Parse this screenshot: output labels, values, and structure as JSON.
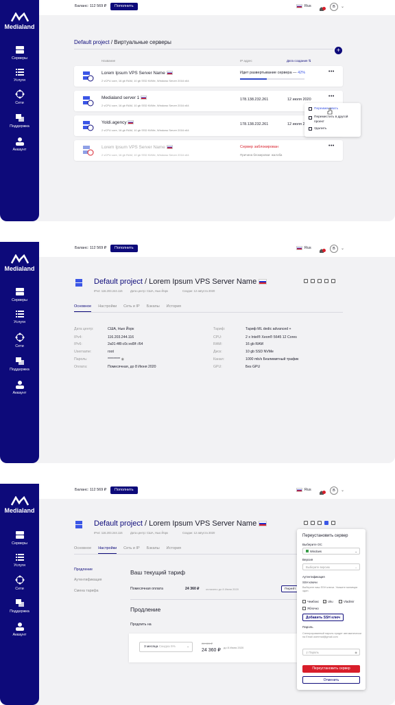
{
  "topbar": {
    "balance": "Баланс: 112 569 ₽",
    "topup": "Пополнить",
    "lang": "Rus",
    "avatar": "B"
  },
  "sidebar": {
    "logo": "Medialand",
    "items": [
      "Серверы",
      "Услуги",
      "Сети",
      "Поддержка",
      "Аккаунт"
    ]
  },
  "list": {
    "project": "Default project",
    "title": " / Виртуальные серверы",
    "col_name": "Название",
    "col_ip": "IP адрес",
    "col_date": "Дата создания",
    "rows": [
      {
        "name": "Lorem Ipsum VPS Server Name",
        "spec": "2 vCPU core, 16 gb RAM, 10 gb SSD NVMe, Windows Server 2016 x64",
        "status": "Идет развертывание сервера — ",
        "pct": "42%",
        "progress": 0.42
      },
      {
        "name": "Medialand server 1",
        "spec": "2 vCPU core, 16 gb RAM, 10 gb SSD NVMe, Windows Server 2016 x64",
        "ip": "178.138.232.261",
        "date": "12 июля 2020"
      },
      {
        "name": "Yoldi.agency",
        "spec": "2 vCPU core, 16 gb RAM, 10 gb SSD NVMe, Windows Server 2016 x64",
        "ip": "178.138.232.261",
        "date": "12 июля 2020"
      },
      {
        "name": "Lorem Ipsum VPS Server Name",
        "spec": "2 vCPU core, 16 gb RAM, 10 gb SSD NVMe, Windows Server 2016 x64",
        "status": "Сервер заблокирован",
        "reason": "Причина блокировки: жалоба"
      }
    ],
    "menu": [
      "Переименовать",
      "Переместить в другой",
      "проект",
      "Удалить"
    ]
  },
  "detail": {
    "project": "Default project",
    "title": " / Lorem Ipsum VPS Server Name",
    "ipv4": "IPv4: 116.203.244.116",
    "dc": "Дата центр: США, Нью Йорк",
    "created": "Создан: 12 августа 2020",
    "tabs": [
      "Основное",
      "Настройки",
      "Сеть и IP",
      "Бэкапы",
      "История"
    ],
    "left": [
      [
        "Дата центр:",
        "США, Нью Йорк"
      ],
      [
        "IPv4:",
        "116.203.244.116"
      ],
      [
        "IPv6:",
        "2a01:4f8:c0c:ed9f::/64"
      ],
      [
        "Username:",
        "root"
      ],
      [
        "Пароль:",
        "*********"
      ],
      [
        "Оплата:",
        "Помесячная, до 8 Июня 2020"
      ]
    ],
    "right": [
      [
        "Тариф:",
        "Тариф ML dedic advanced +"
      ],
      [
        "CPU:",
        "2 x Intel® Xeon® 5645 12 Cores"
      ],
      [
        "RAM:",
        "16 gb RAM"
      ],
      [
        "Диск:",
        "10 gb SSD NVMe"
      ],
      [
        "Канал:",
        "1000 mb/s Безлимитный трафик"
      ],
      [
        "GPU:",
        "Без GPU"
      ]
    ]
  },
  "settings": {
    "lnav": [
      "Продление",
      "Аутентификация",
      "Смена тарифа"
    ],
    "tariff_h": "Ваш текущий тариф",
    "pay_label": "Помесячная оплата",
    "pay_value": "24 360 ₽",
    "pay_note": "оплачено до 8 Июня 2020",
    "pay_btn": "Перейт",
    "renew_h": "Продление",
    "renew_label": "Продлить на",
    "period": "3 месяца",
    "discount": "Скидка 5%",
    "old_price": "28 920 ₽",
    "new_price": "24 360 ₽",
    "until": "до 8 Июня 2020"
  },
  "modal": {
    "title": "Переустановить сервер",
    "os_label": "Выберите ОС",
    "os_value": "Windows",
    "ver_label": "Версия",
    "ver_placeholder": "Выберите версию",
    "auth": "Аутентификация",
    "ssh": "SSH ключи",
    "ssh_hint": "Выберете ваш SSH ключи. Укажите минимум один.",
    "keys": [
      "Чембокс",
      "Uku",
      "Vladimir",
      "Яблочко"
    ],
    "add_key": "Добавить SSH ключ",
    "pwd": "Пароль",
    "pwd_hint": "Сгенерированный пароль придет автоматически на Email userrmal@gmail.com",
    "pwd_placeholder": "Пароль",
    "submit": "Переустановить сервер",
    "cancel": "Отменить"
  }
}
